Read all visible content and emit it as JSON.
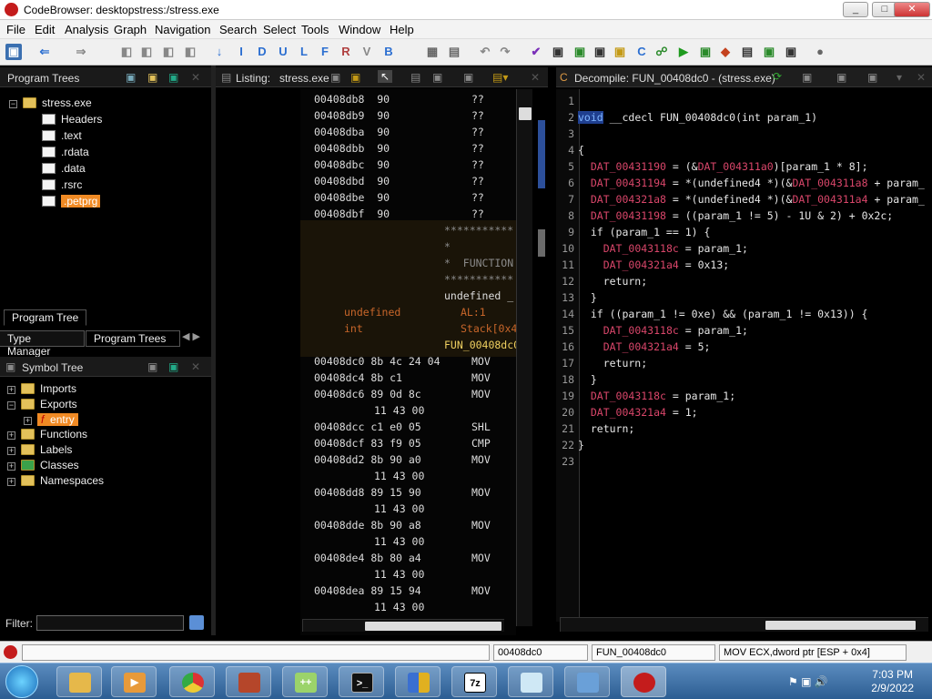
{
  "window": {
    "title": "CodeBrowser: desktopstress:/stress.exe"
  },
  "menu": [
    "File",
    "Edit",
    "Analysis",
    "Graph",
    "Navigation",
    "Search",
    "Select",
    "Tools",
    "Window",
    "Help"
  ],
  "toolbar_letters": [
    "I",
    "D",
    "U",
    "L",
    "F",
    "R",
    "V",
    "B"
  ],
  "program_trees": {
    "title": "Program Trees",
    "root": "stress.exe",
    "items": [
      "Headers",
      ".text",
      ".rdata",
      ".data",
      ".rsrc",
      ".petprg"
    ],
    "tab": "Program Tree",
    "bottom_tabs": [
      "Type Manager",
      "Program Trees"
    ]
  },
  "symbol_tree": {
    "title": "Symbol Tree",
    "items": [
      "Imports",
      "Exports",
      "entry",
      "Functions",
      "Labels",
      "Classes",
      "Namespaces"
    ],
    "filter_label": "Filter:"
  },
  "listing": {
    "title": "Listing:",
    "file": "stress.exe",
    "bytes_rows": [
      {
        "addr": "00408db8",
        "b": "90",
        "m": "??"
      },
      {
        "addr": "00408db9",
        "b": "90",
        "m": "??"
      },
      {
        "addr": "00408dba",
        "b": "90",
        "m": "??"
      },
      {
        "addr": "00408dbb",
        "b": "90",
        "m": "??"
      },
      {
        "addr": "00408dbc",
        "b": "90",
        "m": "??"
      },
      {
        "addr": "00408dbd",
        "b": "90",
        "m": "??"
      },
      {
        "addr": "00408dbe",
        "b": "90",
        "m": "??"
      },
      {
        "addr": "00408dbf",
        "b": "90",
        "m": "??"
      }
    ],
    "stars1": "***********",
    "star2": "*",
    "function_line": "*  FUNCTION",
    "stars3": "***********",
    "undefined": "undefined _",
    "var_type1": "undefined",
    "var_loc1": "AL:1",
    "var_type2": "int",
    "var_loc2": "Stack[0x4",
    "func_label": "FUN_00408dc0",
    "code_rows": [
      {
        "addr": "00408dc0",
        "b": "8b 4c 24 04",
        "m": "MOV"
      },
      {
        "addr": "00408dc4",
        "b": "8b c1",
        "m": "MOV"
      },
      {
        "addr": "00408dc6",
        "b": "89 0d 8c",
        "m": "MOV"
      },
      {
        "addr": "",
        "b": "11 43 00",
        "m": ""
      },
      {
        "addr": "00408dcc",
        "b": "c1 e0 05",
        "m": "SHL"
      },
      {
        "addr": "00408dcf",
        "b": "83 f9 05",
        "m": "CMP"
      },
      {
        "addr": "00408dd2",
        "b": "8b 90 a0",
        "m": "MOV"
      },
      {
        "addr": "",
        "b": "11 43 00",
        "m": ""
      },
      {
        "addr": "00408dd8",
        "b": "89 15 90",
        "m": "MOV"
      },
      {
        "addr": "",
        "b": "11 43 00",
        "m": ""
      },
      {
        "addr": "00408dde",
        "b": "8b 90 a8",
        "m": "MOV"
      },
      {
        "addr": "",
        "b": "11 43 00",
        "m": ""
      },
      {
        "addr": "00408de4",
        "b": "8b 80 a4",
        "m": "MOV"
      },
      {
        "addr": "",
        "b": "11 43 00",
        "m": ""
      },
      {
        "addr": "00408dea",
        "b": "89 15 94",
        "m": "MOV"
      },
      {
        "addr": "",
        "b": "11 43 00",
        "m": ""
      }
    ]
  },
  "decompile": {
    "title": "Decompile: FUN_00408dc0 - (stress.exe)",
    "lines": [
      "",
      "void __cdecl FUN_00408dc0(int param_1)",
      "",
      "{",
      "  DAT_00431190 = (&DAT_004311a0)[param_1 * 8];",
      "  DAT_00431194 = *(undefined4 *)(&DAT_004311a8 + param_",
      "  DAT_004321a8 = *(undefined4 *)(&DAT_004311a4 + param_",
      "  DAT_00431198 = ((param_1 != 5) - 1U & 2) + 0x2c;",
      "  if (param_1 == 1) {",
      "    DAT_0043118c = param_1;",
      "    DAT_004321a4 = 0x13;",
      "    return;",
      "  }",
      "  if ((param_1 != 0xe) && (param_1 != 0x13)) {",
      "    DAT_0043118c = param_1;",
      "    DAT_004321a4 = 5;",
      "    return;",
      "  }",
      "  DAT_0043118c = param_1;",
      "  DAT_004321a4 = 1;",
      "  return;",
      "}",
      ""
    ]
  },
  "status": {
    "addr": "00408dc0",
    "func": "FUN_00408dc0",
    "instr": "MOV ECX,dword ptr [ESP + 0x4]"
  },
  "taskbar": {
    "time": "7:03 PM",
    "date": "2/9/2022",
    "archive_label": "7z"
  }
}
